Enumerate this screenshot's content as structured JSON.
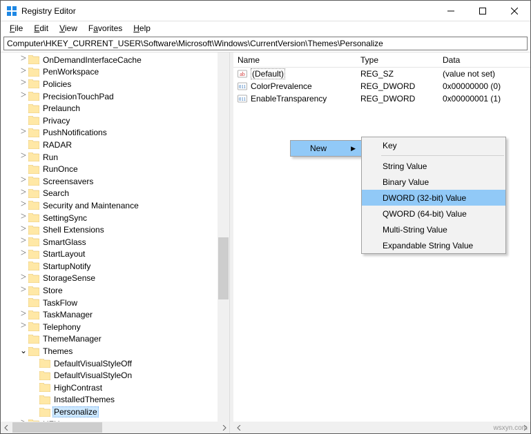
{
  "window": {
    "title": "Registry Editor"
  },
  "menubar": {
    "file": "File",
    "edit": "Edit",
    "view": "View",
    "favorites": "Favorites",
    "help": "Help"
  },
  "address": "Computer\\HKEY_CURRENT_USER\\Software\\Microsoft\\Windows\\CurrentVersion\\Themes\\Personalize",
  "tree": [
    {
      "indent": 6,
      "tog": ">",
      "label": "OnDemandInterfaceCache"
    },
    {
      "indent": 6,
      "tog": ">",
      "label": "PenWorkspace"
    },
    {
      "indent": 6,
      "tog": ">",
      "label": "Policies"
    },
    {
      "indent": 6,
      "tog": ">",
      "label": "PrecisionTouchPad"
    },
    {
      "indent": 6,
      "tog": "",
      "label": "Prelaunch"
    },
    {
      "indent": 6,
      "tog": "",
      "label": "Privacy"
    },
    {
      "indent": 6,
      "tog": ">",
      "label": "PushNotifications"
    },
    {
      "indent": 6,
      "tog": "",
      "label": "RADAR"
    },
    {
      "indent": 6,
      "tog": ">",
      "label": "Run"
    },
    {
      "indent": 6,
      "tog": "",
      "label": "RunOnce"
    },
    {
      "indent": 6,
      "tog": ">",
      "label": "Screensavers"
    },
    {
      "indent": 6,
      "tog": ">",
      "label": "Search"
    },
    {
      "indent": 6,
      "tog": ">",
      "label": "Security and Maintenance"
    },
    {
      "indent": 6,
      "tog": ">",
      "label": "SettingSync"
    },
    {
      "indent": 6,
      "tog": ">",
      "label": "Shell Extensions"
    },
    {
      "indent": 6,
      "tog": ">",
      "label": "SmartGlass"
    },
    {
      "indent": 6,
      "tog": ">",
      "label": "StartLayout"
    },
    {
      "indent": 6,
      "tog": "",
      "label": "StartupNotify"
    },
    {
      "indent": 6,
      "tog": ">",
      "label": "StorageSense"
    },
    {
      "indent": 6,
      "tog": ">",
      "label": "Store"
    },
    {
      "indent": 6,
      "tog": "",
      "label": "TaskFlow"
    },
    {
      "indent": 6,
      "tog": ">",
      "label": "TaskManager"
    },
    {
      "indent": 6,
      "tog": ">",
      "label": "Telephony"
    },
    {
      "indent": 6,
      "tog": "",
      "label": "ThemeManager"
    },
    {
      "indent": 6,
      "tog": "v",
      "label": "Themes"
    },
    {
      "indent": 7,
      "tog": "",
      "label": "DefaultVisualStyleOff"
    },
    {
      "indent": 7,
      "tog": "",
      "label": "DefaultVisualStyleOn"
    },
    {
      "indent": 7,
      "tog": "",
      "label": "HighContrast"
    },
    {
      "indent": 7,
      "tog": "",
      "label": "InstalledThemes"
    },
    {
      "indent": 7,
      "tog": "",
      "label": "Personalize",
      "selected": true
    },
    {
      "indent": 6,
      "tog": ">",
      "label": "UFH"
    }
  ],
  "list": {
    "headers": {
      "name": "Name",
      "type": "Type",
      "data": "Data"
    },
    "rows": [
      {
        "icon": "ab",
        "name": "(Default)",
        "type": "REG_SZ",
        "data": "(value not set)",
        "default": true
      },
      {
        "icon": "dw",
        "name": "ColorPrevalence",
        "type": "REG_DWORD",
        "data": "0x00000000 (0)"
      },
      {
        "icon": "dw",
        "name": "EnableTransparency",
        "type": "REG_DWORD",
        "data": "0x00000001 (1)"
      }
    ]
  },
  "context": {
    "sub_label": "New",
    "items": [
      {
        "label": "Key"
      },
      {
        "sep": true
      },
      {
        "label": "String Value"
      },
      {
        "label": "Binary Value"
      },
      {
        "label": "DWORD (32-bit) Value",
        "hover": true
      },
      {
        "label": "QWORD (64-bit) Value"
      },
      {
        "label": "Multi-String Value"
      },
      {
        "label": "Expandable String Value"
      }
    ]
  },
  "watermark": "wsxyn.com"
}
